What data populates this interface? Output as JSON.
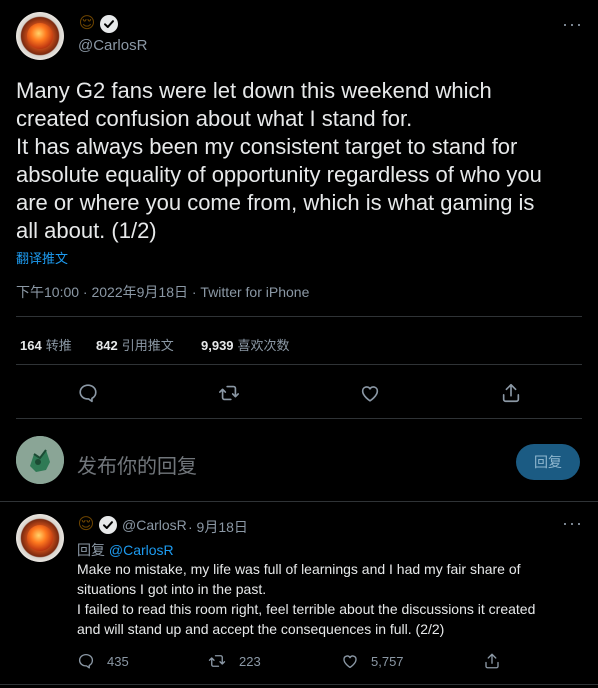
{
  "main_tweet": {
    "emoji": "😌",
    "handle": "@CarlosR",
    "text": "Many G2 fans were let down this weekend which\ncreated confusion about what I stand for.\nIt has always been my consistent target to stand for\nabsolute equality of opportunity regardless of who you\nare or where you come from, which is what gaming is\nall about. (1/2)",
    "translate_label": "翻译推文",
    "timestamp": "下午10:00 · 2022年9月18日 · Twitter for iPhone",
    "stats": [
      {
        "value": "164",
        "label": "转推"
      },
      {
        "value": "842",
        "label": "引用推文"
      },
      {
        "value": "9,939",
        "label": "喜欢次数"
      }
    ],
    "actions": [
      "reply-icon",
      "retweet-icon",
      "like-icon",
      "share-icon"
    ]
  },
  "composer": {
    "placeholder": "发布你的回复",
    "button_label": "回复"
  },
  "reply_tweet": {
    "emoji": "😌",
    "handle": "@CarlosR",
    "date": "· 9月18日",
    "reply_prefix": "回复",
    "reply_to": "@CarlosR",
    "text": "Make no mistake, my life was full of learnings and I had my fair share of\nsituations I got into in the past.\nI failed to read this room right, feel terrible about the discussions it created\nand will stand up and accept the consequences in full. (2/2)",
    "counts": {
      "replies": "435",
      "retweets": "223",
      "likes": "5,757"
    }
  },
  "colors": {
    "background": "#000000",
    "accent": "#1d9bf0",
    "muted": "#8b98a5",
    "divider": "#2f3336"
  }
}
